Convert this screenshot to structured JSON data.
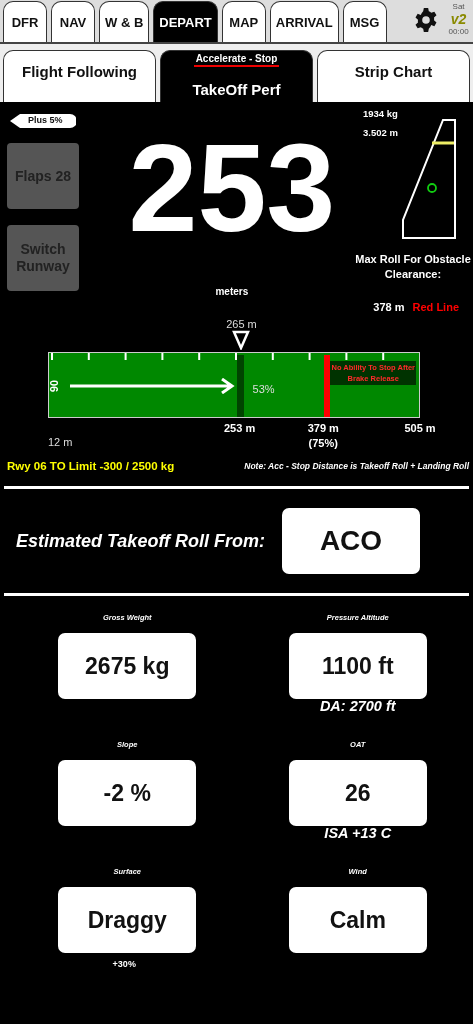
{
  "nav_tabs": [
    {
      "label": "DFR",
      "selected": false
    },
    {
      "label": "NAV",
      "selected": false
    },
    {
      "label": "W & B",
      "selected": false
    },
    {
      "label": "DEPART",
      "selected": true
    },
    {
      "label": "MAP",
      "selected": false
    },
    {
      "label": "ARRIVAL",
      "selected": false
    },
    {
      "label": "MSG",
      "selected": false
    }
  ],
  "clock": {
    "day": "Sat",
    "version": "v2",
    "time": "00:00"
  },
  "sub_tabs": [
    {
      "label": "Flight Following",
      "selected": false
    },
    {
      "label": "TakeOff Perf",
      "caption": "Accelerate - Stop",
      "selected": true
    },
    {
      "label": "Strip Chart",
      "selected": false
    }
  ],
  "adjustment_tag": "Plus 5%",
  "side_buttons": [
    "Flaps 28",
    "Switch Runway"
  ],
  "roll": {
    "value": "253",
    "unit": "meters"
  },
  "gauge": {
    "weight": "1934 kg",
    "distance": "3.502 m",
    "title": "Max Roll For Obstacle Clearance:",
    "reading": "378 m",
    "status": "Red Line"
  },
  "runway": {
    "name": "06",
    "start": "12 m",
    "end": "505 m",
    "marker": {
      "label": "265 m",
      "level": 0.52
    },
    "roll_mark": {
      "percent": "53%",
      "label": "253 m",
      "level": 0.515
    },
    "stop_line": {
      "warning": "No Ability To Stop After Brake Release",
      "label": "379 m",
      "share": "(75%)",
      "level": 0.74
    }
  },
  "limit_text": "Rwy 06 TO Limit -300 / 2500 kg",
  "note": "Note: Acc - Stop Distance is Takeoff Roll + Landing Roll",
  "estimate": {
    "label": "Estimated Takeoff Roll From:",
    "value": "ACO"
  },
  "fields": [
    {
      "label": "Gross Weight",
      "value": "2675 kg"
    },
    {
      "label": "Pressure Altitude",
      "value": "1100 ft",
      "note": {
        "kind": "detail",
        "text": "DA: 2700 ft"
      }
    },
    {
      "label": "Slope",
      "value": "-2 %"
    },
    {
      "label": "OAT",
      "value": "26",
      "note": {
        "kind": "detail",
        "text": "ISA +13 C"
      }
    },
    {
      "label": "Surface",
      "value": "Draggy",
      "note": {
        "kind": "factor",
        "text": "+30%"
      }
    },
    {
      "label": "Wind",
      "value": "Calm"
    }
  ]
}
